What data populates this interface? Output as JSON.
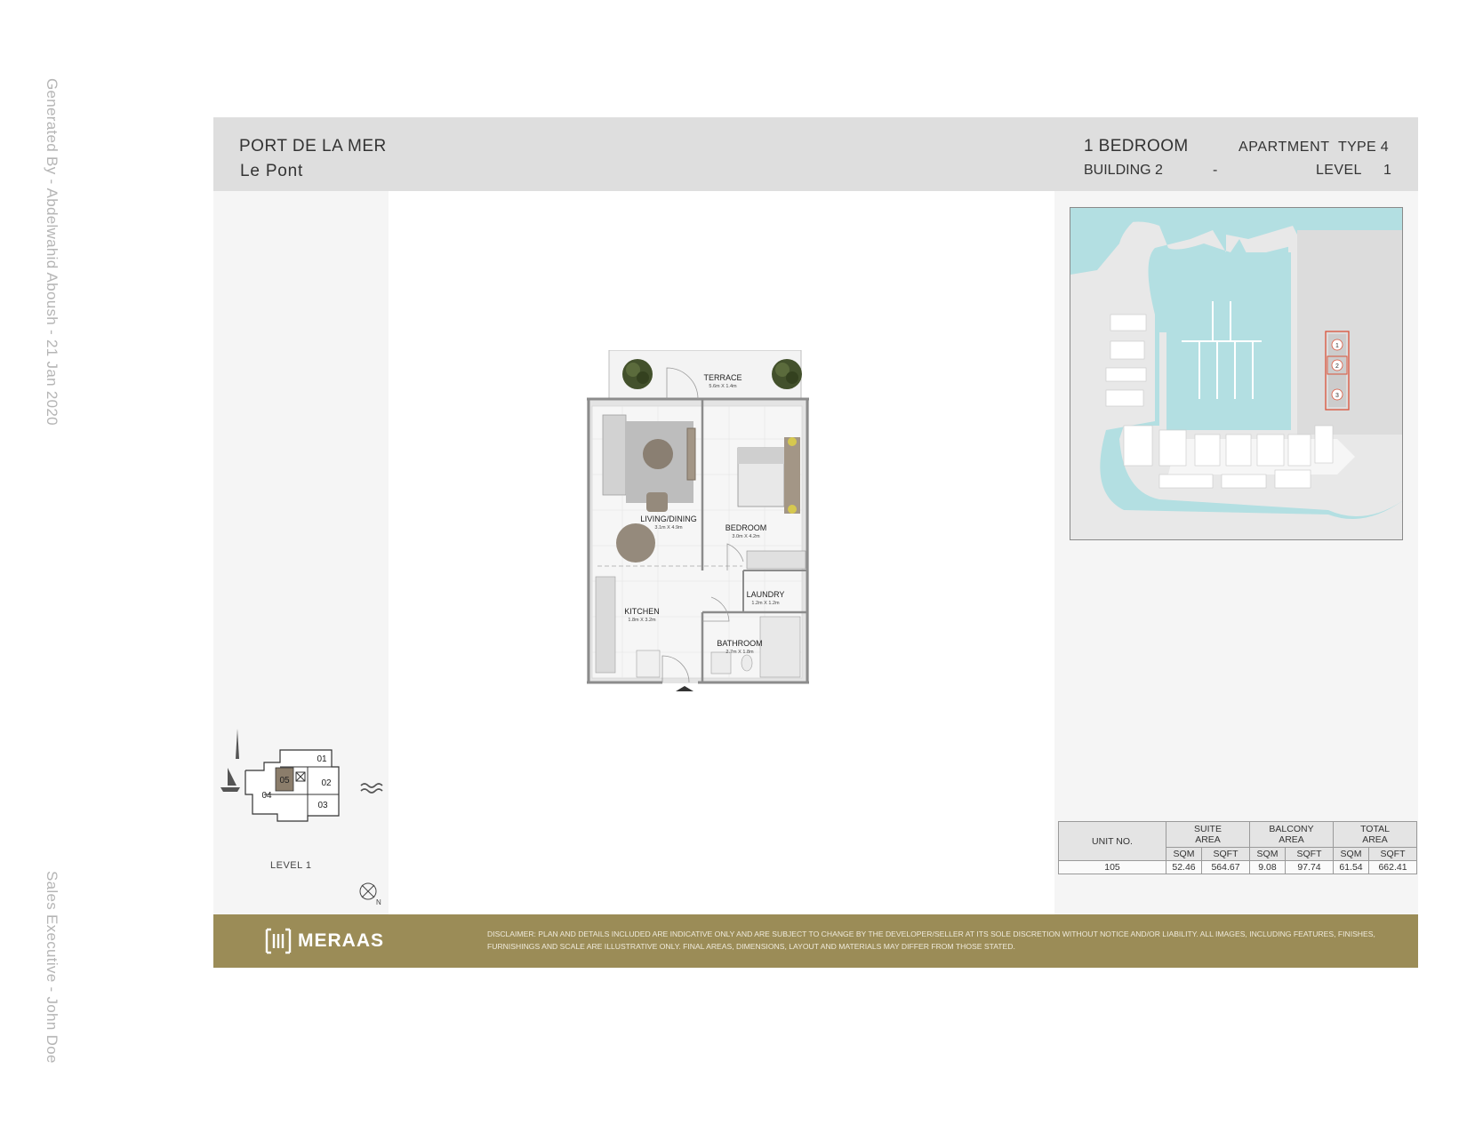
{
  "watermark": {
    "generated_by": "Generated By - Abdelwahid Aboush - 21 Jan 2020",
    "sales_exec": "Sales Executive - John Doe"
  },
  "header": {
    "project": "PORT DE LA MER",
    "subproject": "Le  Pont",
    "bedroom": "1 BEDROOM",
    "apartment_label": "APARTMENT",
    "apartment_type": "TYPE 4",
    "building": "BUILDING 2",
    "building_dash": "-",
    "level_label": "LEVEL",
    "level_value": "1"
  },
  "floorplan": {
    "rooms": [
      {
        "name": "TERRACE",
        "dims": "5.6m X 1.4m"
      },
      {
        "name": "LIVING/DINING",
        "dims": "3.1m X 4.9m"
      },
      {
        "name": "BEDROOM",
        "dims": "3.0m X 4.2m"
      },
      {
        "name": "LAUNDRY",
        "dims": "1.2m X 1.2m"
      },
      {
        "name": "KITCHEN",
        "dims": "1.8m X 3.2m"
      },
      {
        "name": "BATHROOM",
        "dims": "2.7m X 1.8m"
      }
    ]
  },
  "keyplan": {
    "units": [
      "01",
      "02",
      "03",
      "04",
      "05"
    ],
    "highlight": "05",
    "level": "LEVEL 1",
    "north": "N"
  },
  "siteplan": {
    "buildings": [
      "1",
      "2",
      "3"
    ],
    "highlight": "2",
    "colors": {
      "water": "#b3dfe2",
      "land": "#e8e8e8",
      "marker": "#d9533a"
    }
  },
  "area_table": {
    "unit_header": "UNIT NO.",
    "groups": [
      {
        "line1": "SUITE",
        "line2": "AREA"
      },
      {
        "line1": "BALCONY",
        "line2": "AREA"
      },
      {
        "line1": "TOTAL",
        "line2": "AREA"
      }
    ],
    "units": [
      "SQM",
      "SQFT"
    ],
    "row": {
      "unit": "105",
      "suite_sqm": "52.46",
      "suite_sqft": "564.67",
      "balcony_sqm": "9.08",
      "balcony_sqft": "97.74",
      "total_sqm": "61.54",
      "total_sqft": "662.41"
    }
  },
  "footer": {
    "brand": "MERAAS",
    "disclaimer": "DISCLAIMER: PLAN AND DETAILS INCLUDED ARE INDICATIVE ONLY AND ARE SUBJECT TO CHANGE BY THE DEVELOPER/SELLER AT ITS SOLE DISCRETION WITHOUT NOTICE AND/OR LIABILITY. ALL IMAGES, INCLUDING FEATURES, FINISHES, FURNISHINGS AND SCALE ARE ILLUSTRATIVE ONLY. FINAL AREAS, DIMENSIONS, LAYOUT AND MATERIALS MAY DIFFER FROM THOSE STATED.",
    "color": "#9b8c57"
  }
}
